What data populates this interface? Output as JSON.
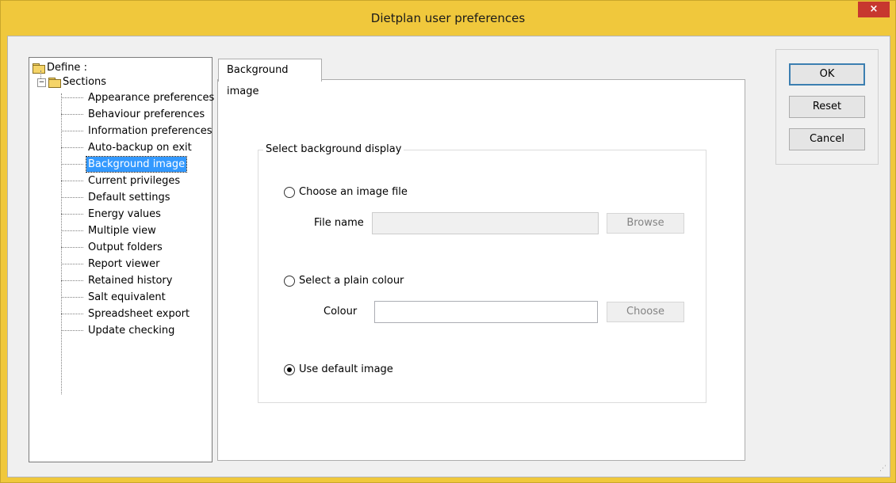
{
  "window": {
    "title": "Dietplan user preferences",
    "close_label": "×"
  },
  "tree": {
    "root_label": "Define :",
    "expander": "−",
    "sections_label": "Sections",
    "items": [
      {
        "label": "Appearance preferences",
        "selected": false
      },
      {
        "label": "Behaviour preferences",
        "selected": false
      },
      {
        "label": "Information preferences",
        "selected": false
      },
      {
        "label": "Auto-backup on exit",
        "selected": false
      },
      {
        "label": "Background image",
        "selected": true
      },
      {
        "label": "Current privileges",
        "selected": false
      },
      {
        "label": "Default settings",
        "selected": false
      },
      {
        "label": "Energy values",
        "selected": false
      },
      {
        "label": "Multiple view",
        "selected": false
      },
      {
        "label": "Output folders",
        "selected": false
      },
      {
        "label": "Report viewer",
        "selected": false
      },
      {
        "label": "Retained history",
        "selected": false
      },
      {
        "label": "Salt equivalent",
        "selected": false
      },
      {
        "label": "Spreadsheet export",
        "selected": false
      },
      {
        "label": "Update checking",
        "selected": false
      }
    ]
  },
  "tab": {
    "label": "Background image"
  },
  "group": {
    "legend": "Select background display",
    "option_image": "Choose an image file",
    "file_name_label": "File name",
    "file_name_value": "",
    "browse_label": "Browse",
    "option_colour": "Select a plain colour",
    "colour_label": "Colour",
    "colour_value": "",
    "choose_label": "Choose",
    "option_default": "Use default image",
    "selected_option": "default"
  },
  "actions": {
    "ok_label": "OK",
    "reset_label": "Reset",
    "cancel_label": "Cancel"
  },
  "colors": {
    "title_bar": "#f0c83c",
    "close_button": "#c7372f",
    "selection": "#3399ff"
  }
}
